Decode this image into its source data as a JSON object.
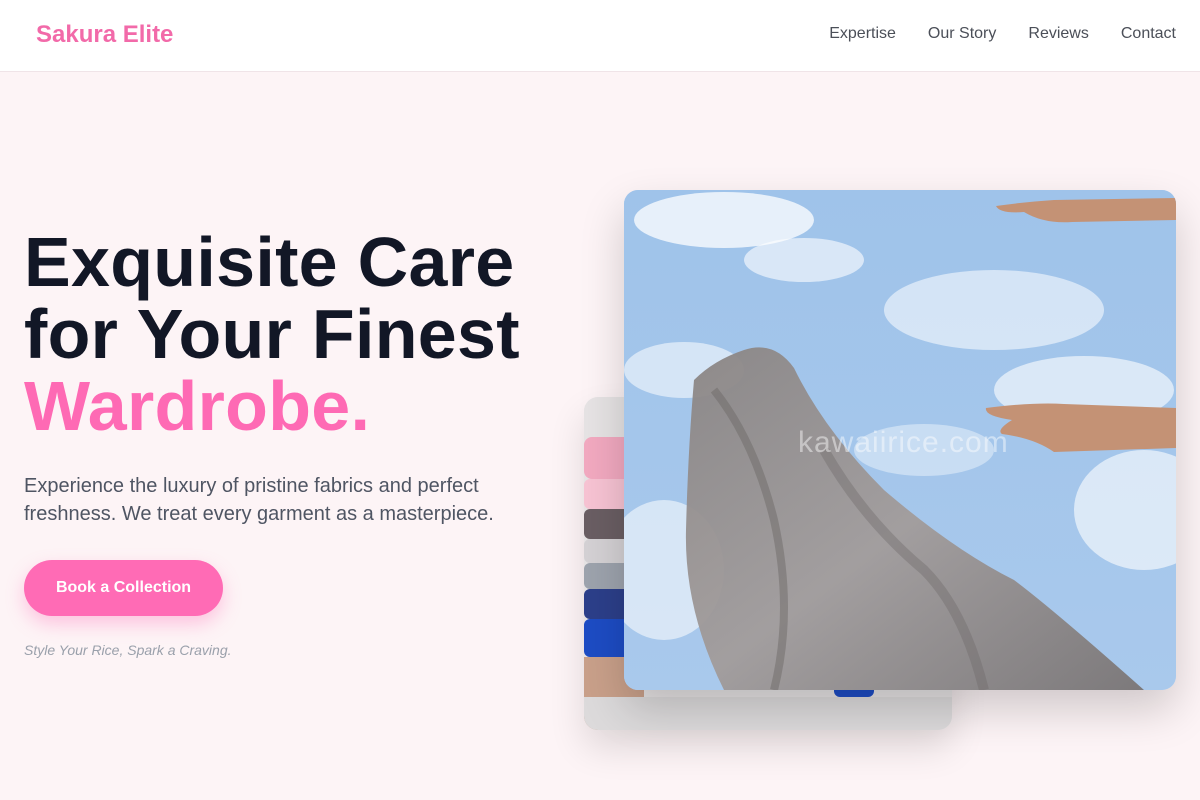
{
  "header": {
    "brand": "Sakura Elite",
    "nav": [
      "Expertise",
      "Our Story",
      "Reviews",
      "Contact"
    ]
  },
  "hero": {
    "headline_line1": "Exquisite Care",
    "headline_line2": "for Your Finest",
    "headline_accent": "Wardrobe.",
    "subtext": "Experience the luxury of pristine fabrics and perfect freshness. We treat every garment as a masterpiece.",
    "cta_label": "Book a Collection",
    "tagline": "Style Your Rice, Spark a Craving."
  },
  "images": {
    "front_watermark": "kawaiirice.com"
  },
  "colors": {
    "brand": "#f26aa9",
    "accent": "#fe6ab4",
    "cta": "#ff6bb5",
    "heading": "#121726",
    "background": "#fdf4f6"
  }
}
